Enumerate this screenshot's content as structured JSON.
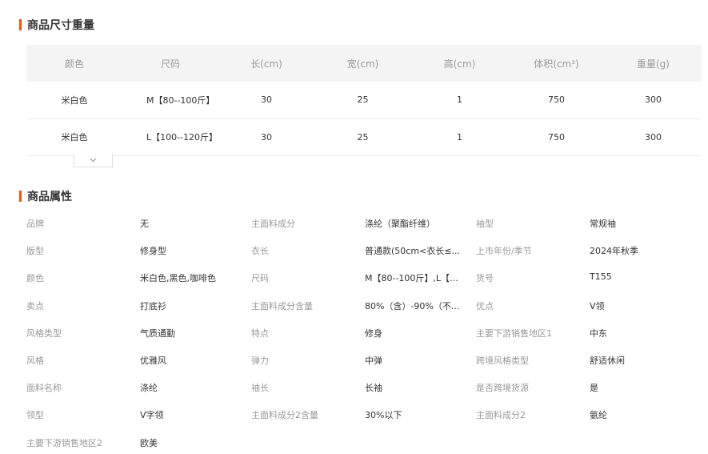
{
  "size_section": {
    "title": "商品尺寸重量",
    "headers": [
      "颜色",
      "尺码",
      "长(cm)",
      "宽(cm)",
      "高(cm)",
      "体积(cm³)",
      "重量(g)"
    ],
    "rows": [
      [
        "米白色",
        "M【80--100斤】",
        "30",
        "25",
        "1",
        "750",
        "300"
      ],
      [
        "米白色",
        "L【100--120斤】",
        "30",
        "25",
        "1",
        "750",
        "300"
      ]
    ],
    "expand_icon": "chevron-down-icon"
  },
  "attr_section": {
    "title": "商品属性",
    "rows": [
      [
        {
          "label": "品牌",
          "value": "无"
        },
        {
          "label": "主面料成分",
          "value": "涤纶（聚酯纤维）"
        },
        {
          "label": "袖型",
          "value": "常规袖"
        }
      ],
      [
        {
          "label": "版型",
          "value": "修身型"
        },
        {
          "label": "衣长",
          "value": "普通款(50cm<衣长≤..."
        },
        {
          "label": "上市年份/季节",
          "value": "2024年秋季"
        }
      ],
      [
        {
          "label": "颜色",
          "value": "米白色,黑色,咖啡色"
        },
        {
          "label": "尺码",
          "value": "M【80--100斤】,L【1..."
        },
        {
          "label": "货号",
          "value": "T155"
        }
      ],
      [
        {
          "label": "卖点",
          "value": "打底衫"
        },
        {
          "label": "主面料成分含量",
          "value": "80%（含）-90%（不..."
        },
        {
          "label": "优点",
          "value": "V领"
        }
      ],
      [
        {
          "label": "风格类型",
          "value": "气质通勤"
        },
        {
          "label": "特点",
          "value": "修身"
        },
        {
          "label": "主要下游销售地区1",
          "value": "中东"
        }
      ],
      [
        {
          "label": "风格",
          "value": "优雅风"
        },
        {
          "label": "弹力",
          "value": "中弹"
        },
        {
          "label": "跨境风格类型",
          "value": "舒适休闲"
        }
      ],
      [
        {
          "label": "面料名称",
          "value": "涤纶"
        },
        {
          "label": "袖长",
          "value": "长袖"
        },
        {
          "label": "是否跨境货源",
          "value": "是"
        }
      ],
      [
        {
          "label": "领型",
          "value": "V字领"
        },
        {
          "label": "主面料成分2含量",
          "value": "30%以下"
        },
        {
          "label": "主面料成分2",
          "value": "氨纶"
        }
      ],
      [
        {
          "label": "主要下游销售地区2",
          "value": "欧美"
        }
      ]
    ]
  },
  "accent_color": "#ff5000"
}
